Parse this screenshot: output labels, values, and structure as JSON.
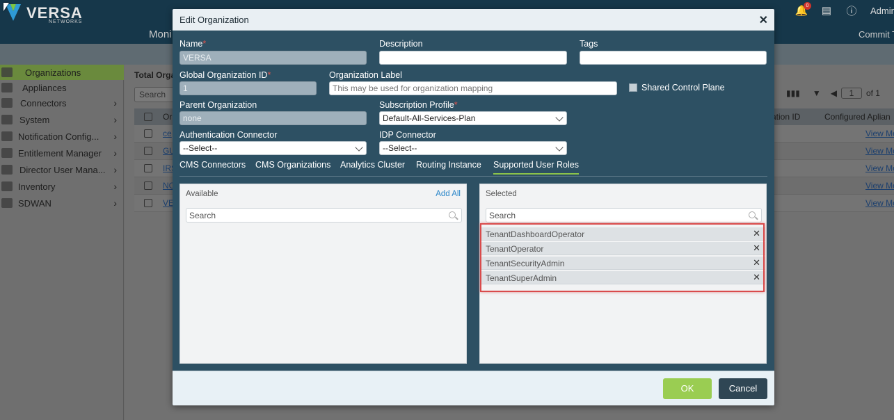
{
  "app": {
    "brand_name": "VERSA",
    "brand_sub": "NETWORKS",
    "admin_label": "Admin",
    "notification_count": "0",
    "nav_monitor": "Moni",
    "nav_commit": "Commit T"
  },
  "sidebar": {
    "items": [
      {
        "label": "Organizations",
        "icon": "organizations-icon",
        "active": true
      },
      {
        "label": "Appliances",
        "icon": "appliances-icon"
      },
      {
        "label": "Connectors",
        "icon": "connectors-icon",
        "expandable": true
      },
      {
        "label": "System",
        "icon": "system-icon",
        "expandable": true
      },
      {
        "label": "Notification Config...",
        "icon": "notification-icon",
        "expandable": true
      },
      {
        "label": "Entitlement Manager",
        "icon": "entitlement-icon",
        "expandable": true
      },
      {
        "label": "Director User Mana...",
        "icon": "users-icon",
        "expandable": true
      },
      {
        "label": "Inventory",
        "icon": "inventory-icon",
        "expandable": true
      },
      {
        "label": "SDWAN",
        "icon": "sdwan-icon",
        "expandable": true
      }
    ]
  },
  "content": {
    "title": "Total Orga",
    "search_placeholder": "Search",
    "columns": {
      "org": "Or",
      "org_id": "ation ID",
      "configured": "Configured Aplian"
    },
    "pager": {
      "page": "1",
      "of": "of 1"
    },
    "rows": [
      {
        "name": "ce",
        "link": "View More"
      },
      {
        "name": "GU",
        "link": "View More"
      },
      {
        "name": "IRS",
        "link": "View More"
      },
      {
        "name": "NO",
        "link": "View More"
      },
      {
        "name": "VE",
        "link": "View More"
      }
    ]
  },
  "modal": {
    "title": "Edit Organization",
    "fields": {
      "name_label": "Name",
      "name_value": "VERSA",
      "description_label": "Description",
      "description_value": "",
      "tags_label": "Tags",
      "tags_value": "",
      "global_org_id_label": "Global Organization ID",
      "global_org_id_value": "1",
      "org_label_label": "Organization Label",
      "org_label_placeholder": "This may be used for organization mapping",
      "shared_control_plane_label": "Shared Control Plane",
      "shared_control_plane_checked": false,
      "parent_org_label": "Parent Organization",
      "parent_org_value": "none",
      "subscription_profile_label": "Subscription Profile",
      "subscription_profile_value": "Default-All-Services-Plan",
      "auth_connector_label": "Authentication Connector",
      "auth_connector_value": "--Select--",
      "idp_connector_label": "IDP Connector",
      "idp_connector_value": "--Select--"
    },
    "tabs": [
      {
        "label": "CMS Connectors"
      },
      {
        "label": "CMS Organizations"
      },
      {
        "label": "Analytics Cluster"
      },
      {
        "label": "Routing Instance"
      },
      {
        "label": "Supported User Roles",
        "active": true
      }
    ],
    "available": {
      "title": "Available",
      "add_all": "Add All",
      "search_placeholder": "Search"
    },
    "selected": {
      "title": "Selected",
      "search_placeholder": "Search",
      "roles": [
        "TenantDashboardOperator",
        "TenantOperator",
        "TenantSecurityAdmin",
        "TenantSuperAdmin"
      ]
    },
    "ok_label": "OK",
    "cancel_label": "Cancel"
  },
  "colors": {
    "modal_body": "#2d5063",
    "accent_green": "#9acd52",
    "highlight_red": "#d94b4b",
    "required_red": "#e0544c"
  }
}
